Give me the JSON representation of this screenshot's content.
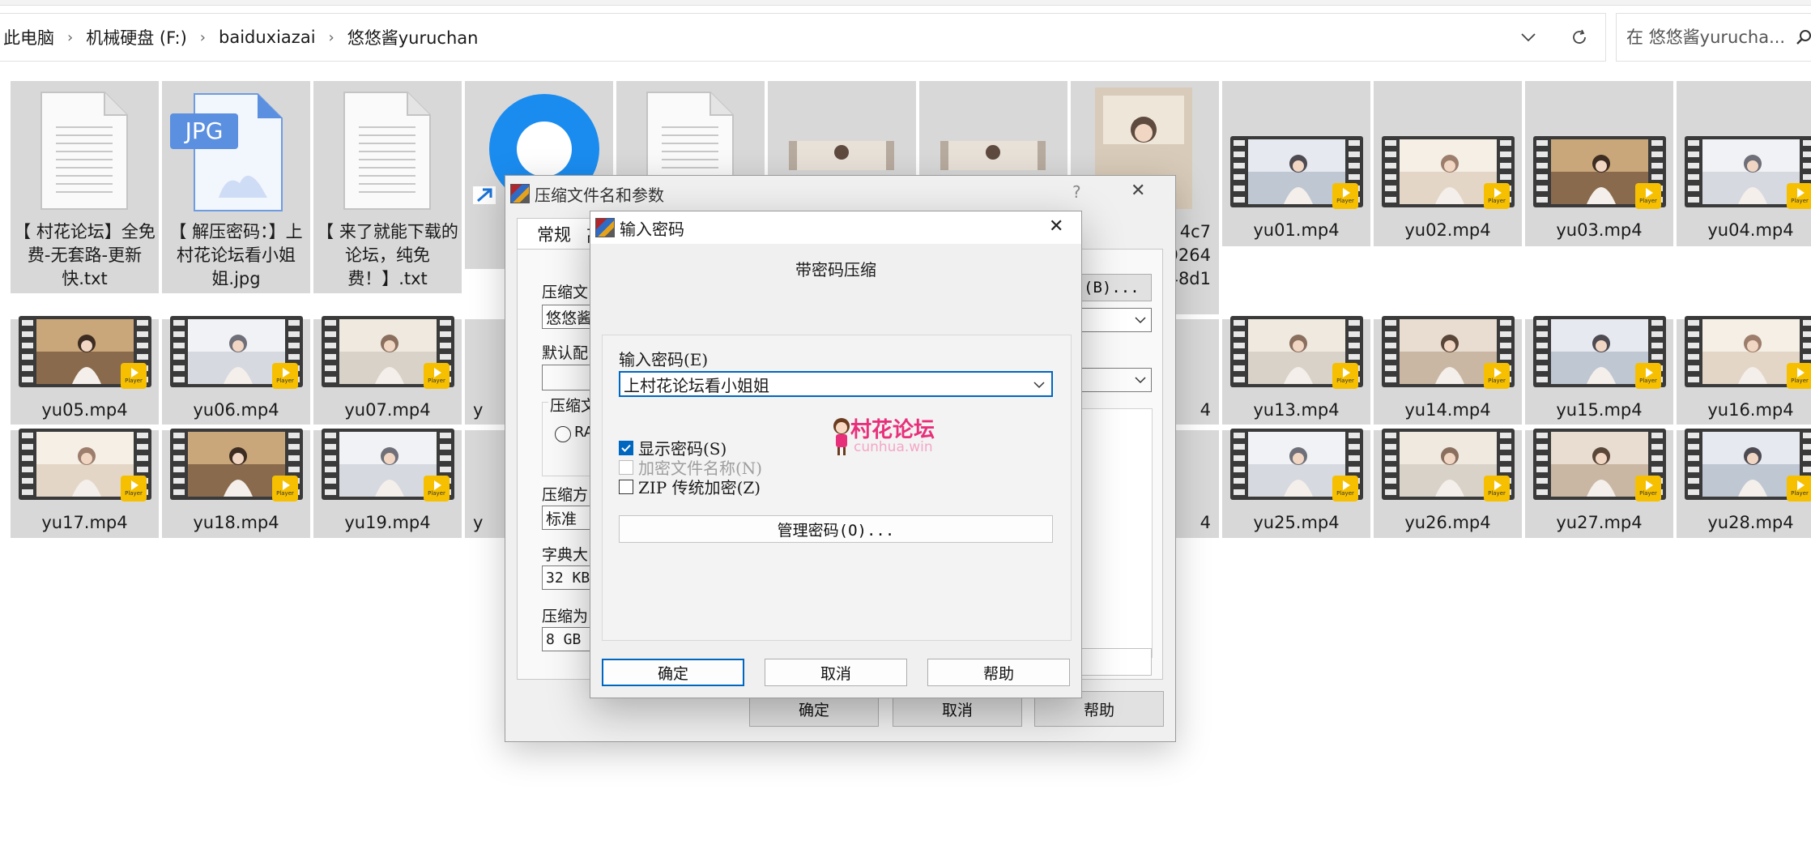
{
  "explorer": {
    "breadcrumbs": [
      "此电脑",
      "机械硬盘 (F:)",
      "baiduxiazai",
      "悠悠酱yuruchan"
    ],
    "breadcrumb_separator": "›",
    "search_placeholder": "在 悠悠酱yurucha...",
    "row1_files": [
      {
        "name": "【 村花论坛】全免费-无套路-更新快.txt",
        "kind": "txt"
      },
      {
        "name": "【 解压密码：】上村花论坛看小姐姐.jpg",
        "kind": "jpg",
        "badge": "JPG"
      },
      {
        "name": "【 来了就能下载的论坛，纯免费！】.txt",
        "kind": "txt"
      },
      {
        "name": "【 ",
        "kind": "browser"
      },
      {
        "name": "",
        "kind": "txt"
      },
      {
        "name": "",
        "kind": "photo"
      },
      {
        "name": "",
        "kind": "photo"
      },
      {
        "name": "4c7\n9264\n48d1",
        "kind": "photo"
      },
      {
        "name": "yu01.mp4",
        "kind": "video"
      },
      {
        "name": "yu02.mp4",
        "kind": "video"
      },
      {
        "name": "yu03.mp4",
        "kind": "video"
      },
      {
        "name": "yu04.mp4",
        "kind": "video"
      }
    ],
    "row2_files": [
      "yu05.mp4",
      "yu06.mp4",
      "yu07.mp4",
      "y",
      "",
      "",
      "",
      "4",
      "yu13.mp4",
      "yu14.mp4",
      "yu15.mp4",
      "yu16.mp4"
    ],
    "row3_files": [
      "yu17.mp4",
      "yu18.mp4",
      "yu19.mp4",
      "y",
      "",
      "",
      "",
      "4",
      "yu25.mp4",
      "yu26.mp4",
      "yu27.mp4",
      "yu28.mp4"
    ],
    "player_badge": "Player"
  },
  "archive_dialog": {
    "title": "压缩文件名和参数",
    "help_glyph": "?",
    "close_glyph": "✕",
    "tabs": [
      "常规",
      "高"
    ],
    "labels": {
      "archive_name": "压缩文",
      "default_profile": "默认配",
      "format_group": "压缩文",
      "format_rar": "RA",
      "method": "压缩方",
      "dict": "字典大",
      "split": "压缩为"
    },
    "values": {
      "archive_name": "悠悠酱",
      "method": "标准",
      "dict": "32 KB",
      "split": "8 GB"
    },
    "browse_button": "(B)...",
    "ok": "确定",
    "cancel": "取消",
    "help": "帮助"
  },
  "password_dialog": {
    "title": "输入密码",
    "close_glyph": "✕",
    "heading": "带密码压缩",
    "password_label": "输入密码(E)",
    "password_value": "上村花论坛看小姐姐",
    "watermark": {
      "title": "村花论坛",
      "subtitle": "cunhua.win"
    },
    "show_password": {
      "label": "显示密码(S)",
      "checked": true
    },
    "encrypt_names": {
      "label": "加密文件名称(N)",
      "checked": false,
      "disabled": true
    },
    "zip_legacy": {
      "label": "ZIP 传统加密(Z)",
      "checked": false
    },
    "manage_button": "管理密码(O)...",
    "ok": "确定",
    "cancel": "取消",
    "help": "帮助"
  },
  "colors": {
    "tile_bg": "#d8d8d8",
    "dialog_bg": "#f0f0f0",
    "accent": "#0067c0",
    "player_badge": "#f6c000",
    "watermark_pink": "#e8307a"
  }
}
